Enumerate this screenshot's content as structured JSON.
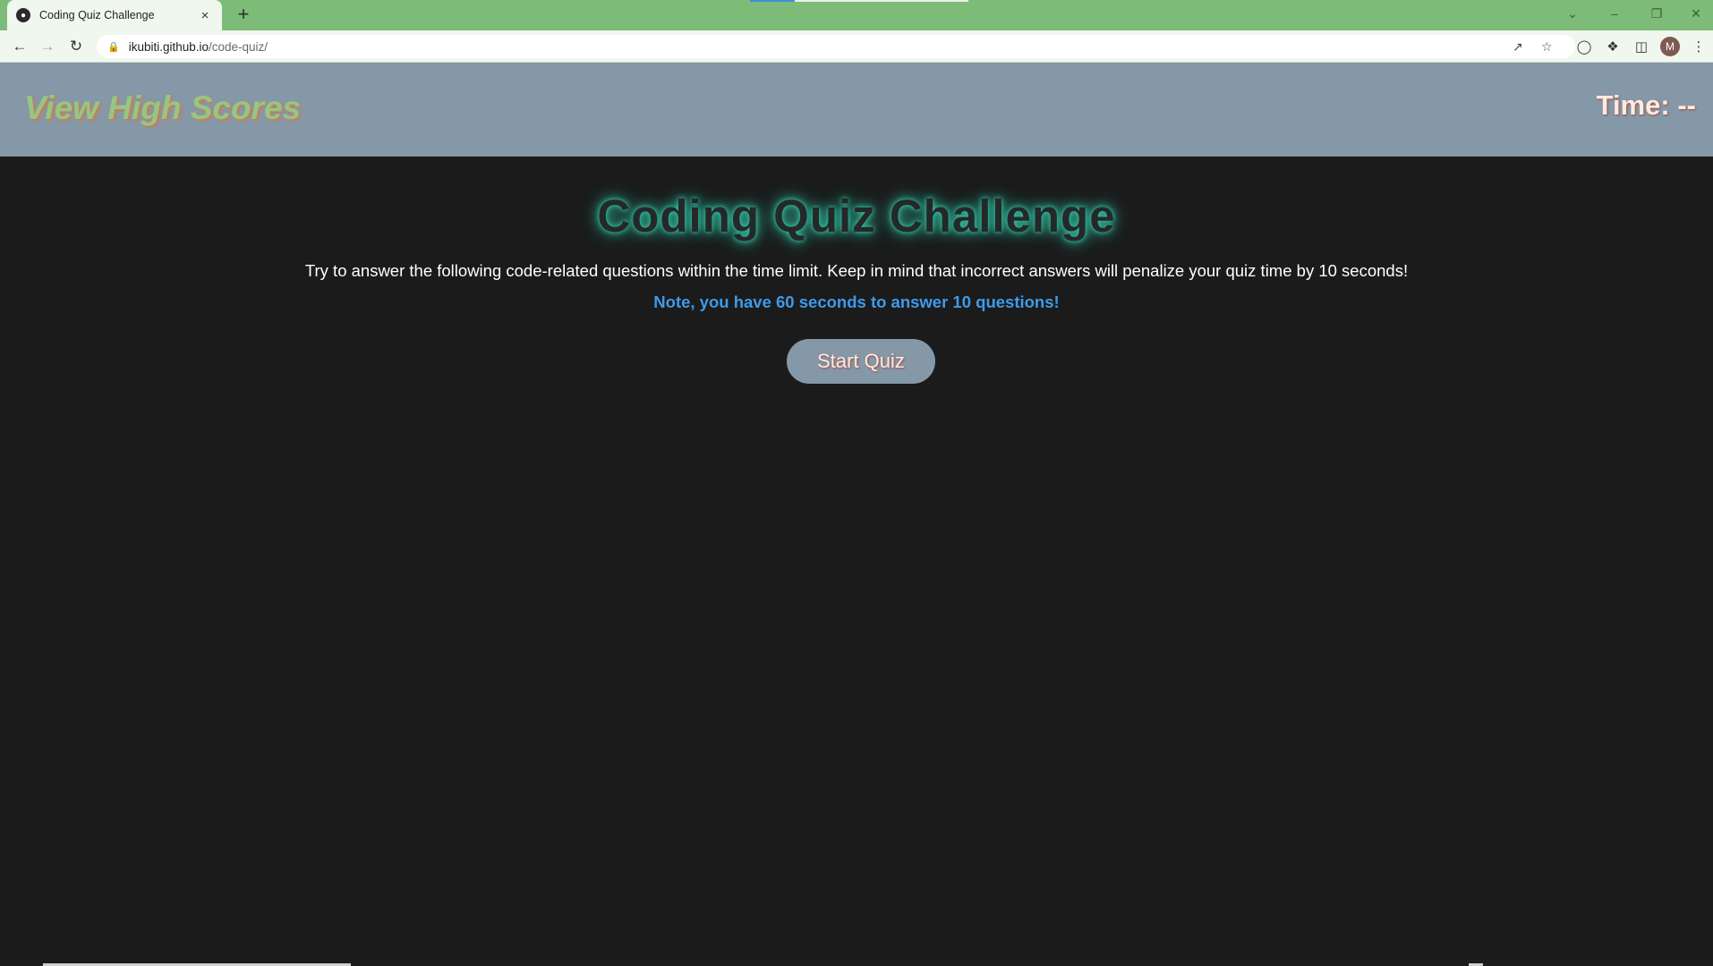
{
  "browser": {
    "tab_title": "Coding Quiz Challenge",
    "tab_close": "×",
    "new_tab": "+",
    "url_host": "ikubiti.github.io",
    "url_path": "/code-quiz/",
    "profile_initial": "M",
    "icons": {
      "back": "back-arrow-icon",
      "forward": "forward-arrow-icon",
      "reload": "reload-icon",
      "lock": "lock-icon",
      "share": "share-icon",
      "bookmark": "star-icon",
      "extension_account": "extension-icon",
      "extensions": "puzzle-icon",
      "side_panel": "side-panel-icon",
      "menu": "kebab-menu-icon"
    },
    "colors": {
      "tab_strip": "#7dbb78",
      "toolbar": "#f0f7ee"
    }
  },
  "page": {
    "high_scores_link": "View High Scores",
    "timer_text": "Time: --",
    "title": "Coding Quiz Challenge",
    "intro": "Try to answer the following code-related questions within the time limit. Keep in mind that incorrect answers will penalize your quiz time by 10 seconds!",
    "note": "Note, you have 60 seconds to answer 10 questions!",
    "start_button": "Start Quiz",
    "colors": {
      "header_bg": "#8598a8",
      "page_bg": "#1b1b1b",
      "link_color": "#98c67e",
      "note_color": "#3d9bea",
      "title_glow": "#38d6b2"
    }
  }
}
